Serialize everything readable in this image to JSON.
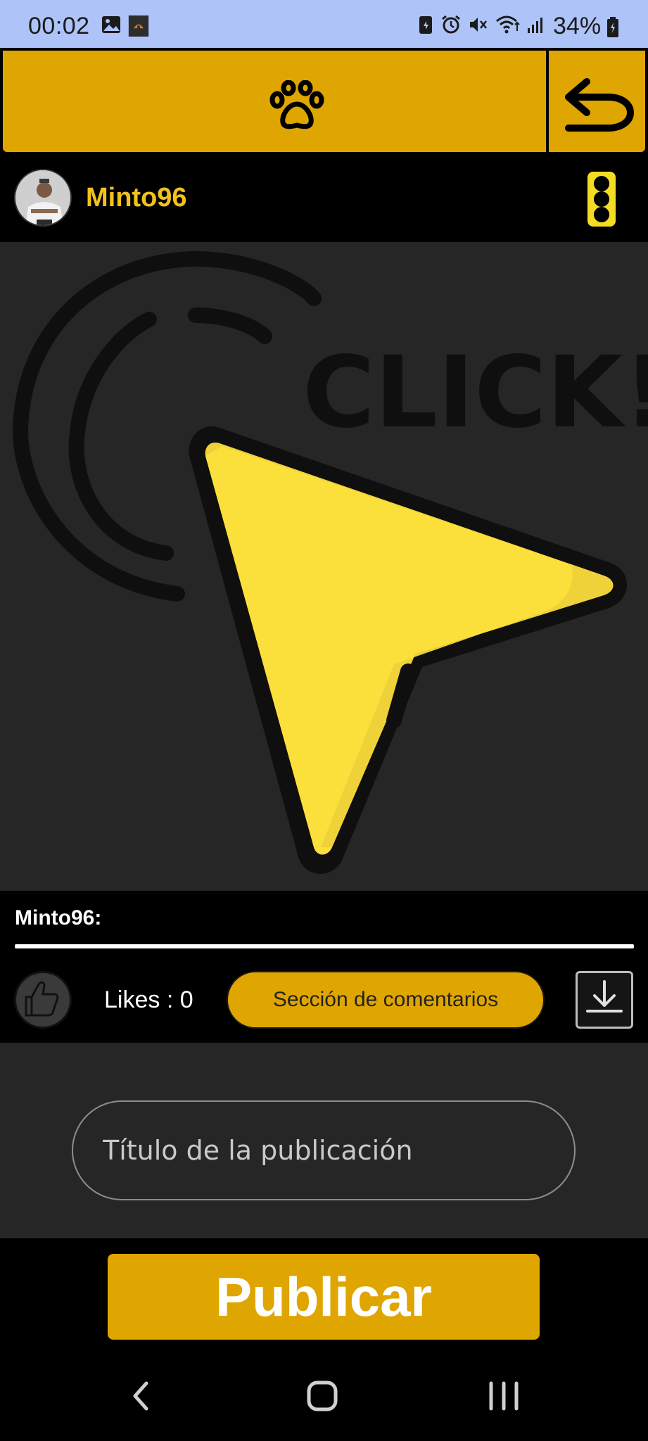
{
  "status_bar": {
    "time": "00:02",
    "battery": "34%",
    "background": "#aec3f7"
  },
  "header": {
    "center_icon": "paw-icon",
    "back_icon": "undo-arrow-icon",
    "accent": "#dfa500"
  },
  "post": {
    "username": "Minto96",
    "username_color": "#f1c21b",
    "menu_icon": "more-vertical-icon",
    "image_text": "CLICK!",
    "caption_user": "Minto96:",
    "likes_text": "Likes : 0",
    "comments_label": "Sección de comentarios",
    "download_icon": "download-icon",
    "like_icon": "thumbs-up-icon"
  },
  "form": {
    "title_placeholder": "Título de la publicación",
    "title_value": "",
    "publish_label": "Publicar"
  },
  "nav": {
    "back": "back-icon",
    "home": "home-icon",
    "recents": "recents-icon"
  }
}
